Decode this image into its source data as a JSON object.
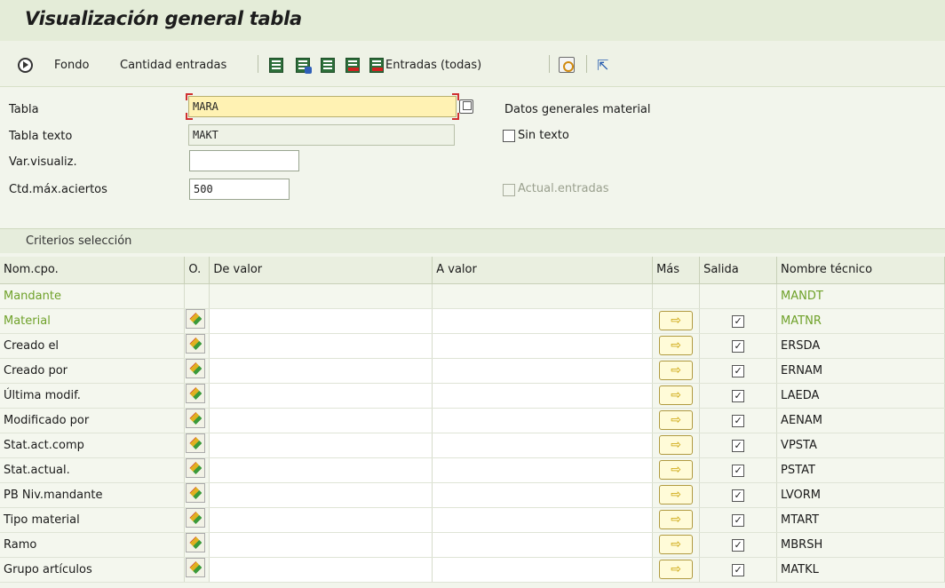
{
  "title": "Visualización general tabla",
  "toolbar": {
    "fondo": "Fondo",
    "cantidad": "Cantidad entradas",
    "entradas_todas": "Entradas (todas)"
  },
  "form": {
    "tabla_label": "Tabla",
    "tabla_value": "MARA",
    "tabla_desc": "Datos generales material",
    "tabla_texto_label": "Tabla texto",
    "tabla_texto_value": "MAKT",
    "sin_texto": "Sin texto",
    "var_label": "Var.visualiz.",
    "var_value": "",
    "ctd_label": "Ctd.máx.aciertos",
    "ctd_value": "500",
    "actual_entradas": "Actual.entradas"
  },
  "section": {
    "title": "Criterios selección"
  },
  "grid": {
    "headers": {
      "name": "Nom.cpo.",
      "op": "O.",
      "de": "De valor",
      "a": "A valor",
      "mas": "Más",
      "salida": "Salida",
      "tech": "Nombre técnico"
    },
    "rows": [
      {
        "name": "Mandante",
        "tech": "MANDT",
        "key": true,
        "output": false
      },
      {
        "name": "Material",
        "tech": "MATNR",
        "key": true,
        "output": true
      },
      {
        "name": "Creado el",
        "tech": "ERSDA",
        "key": false,
        "output": true
      },
      {
        "name": "Creado por",
        "tech": "ERNAM",
        "key": false,
        "output": true
      },
      {
        "name": "Última modif.",
        "tech": "LAEDA",
        "key": false,
        "output": true
      },
      {
        "name": "Modificado por",
        "tech": "AENAM",
        "key": false,
        "output": true
      },
      {
        "name": "Stat.act.comp",
        "tech": "VPSTA",
        "key": false,
        "output": true
      },
      {
        "name": "Stat.actual.",
        "tech": "PSTAT",
        "key": false,
        "output": true
      },
      {
        "name": "PB Niv.mandante",
        "tech": "LVORM",
        "key": false,
        "output": true
      },
      {
        "name": "Tipo material",
        "tech": "MTART",
        "key": false,
        "output": true
      },
      {
        "name": "Ramo",
        "tech": "MBRSH",
        "key": false,
        "output": true
      },
      {
        "name": "Grupo artículos",
        "tech": "MATKL",
        "key": false,
        "output": true
      }
    ]
  }
}
